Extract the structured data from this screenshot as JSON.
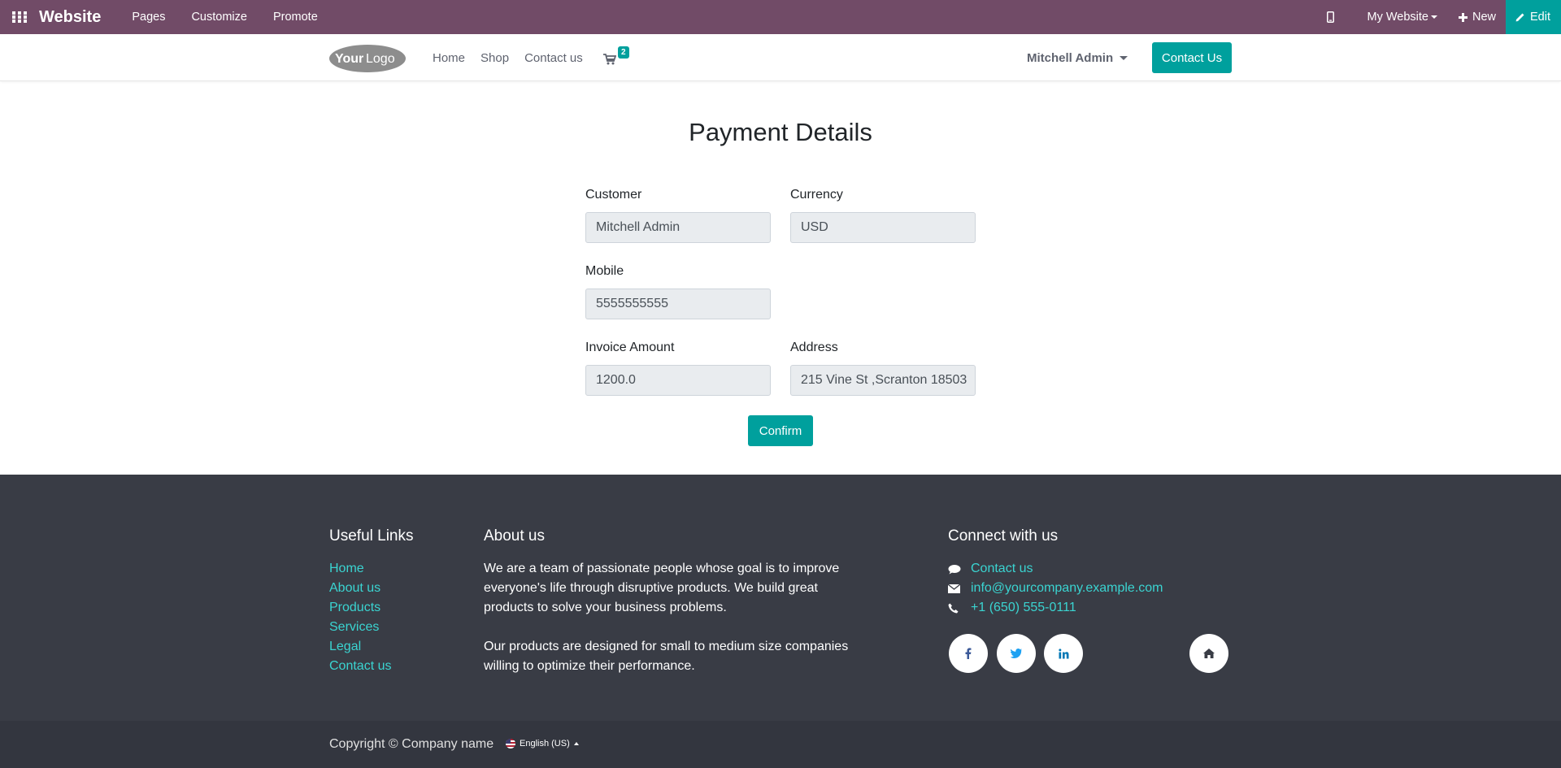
{
  "adminbar": {
    "brand": "Website",
    "menu": [
      "Pages",
      "Customize",
      "Promote"
    ],
    "website_selector": "My Website",
    "new_label": "New",
    "edit_label": "Edit",
    "color": "#714b67",
    "accent": "#00a09d"
  },
  "header": {
    "logo_text": "YourLogo",
    "nav": [
      "Home",
      "Shop",
      "Contact us"
    ],
    "cart_count": "2",
    "user_name": "Mitchell Admin",
    "contact_button": "Contact Us"
  },
  "form": {
    "title": "Payment Details",
    "customer_label": "Customer",
    "customer_value": "Mitchell Admin",
    "currency_label": "Currency",
    "currency_value": "USD",
    "mobile_label": "Mobile",
    "mobile_value": "5555555555",
    "amount_label": "Invoice Amount",
    "amount_value": "1200.0",
    "address_label": "Address",
    "address_value": "215 Vine St ,Scranton 18503",
    "confirm_label": "Confirm"
  },
  "footer": {
    "useful_links_title": "Useful Links",
    "useful_links": [
      "Home",
      "About us",
      "Products",
      "Services",
      "Legal",
      "Contact us"
    ],
    "about_title": "About us",
    "about_p1": "We are a team of passionate people whose goal is to improve everyone's life through disruptive products. We build great products to solve your business problems.",
    "about_p2": "Our products are designed for small to medium size companies willing to optimize their performance.",
    "connect_title": "Connect with us",
    "contact_us": "Contact us",
    "email": "info@yourcompany.example.com",
    "phone": "+1 (650) 555-0111",
    "social_icons": [
      "facebook-icon",
      "twitter-icon",
      "linkedin-icon",
      "home-icon"
    ],
    "link_color": "#3ad4d1"
  },
  "copyright": {
    "text": "Copyright © Company name",
    "language": "English (US)"
  }
}
